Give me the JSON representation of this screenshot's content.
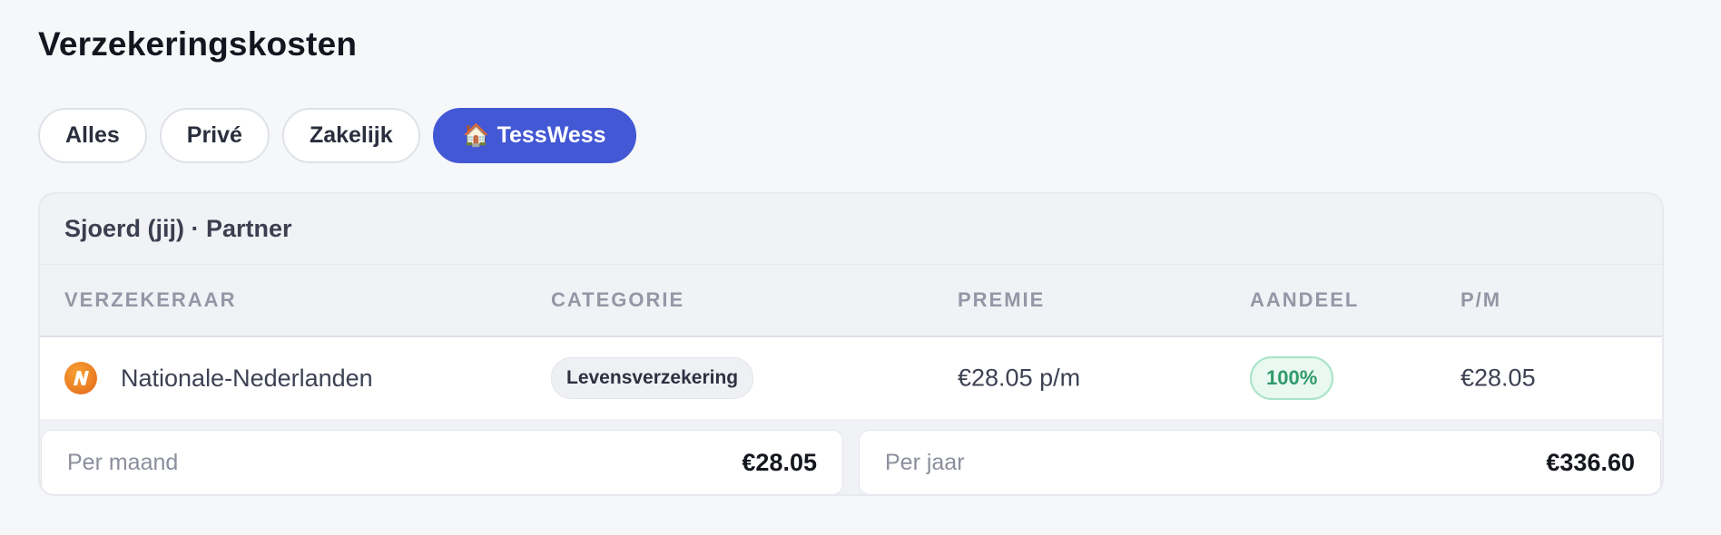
{
  "page": {
    "title": "Verzekeringskosten"
  },
  "filters": [
    {
      "label": "Alles",
      "active": false
    },
    {
      "label": "Privé",
      "active": false
    },
    {
      "label": "Zakelijk",
      "active": false
    },
    {
      "label": "TessWess",
      "active": true,
      "icon": "house-icon"
    }
  ],
  "group": {
    "title": "Sjoerd (jij) · Partner"
  },
  "table": {
    "columns": [
      "VERZEKERAAR",
      "CATEGORIE",
      "PREMIE",
      "AANDEEL",
      "P/M"
    ],
    "rows": [
      {
        "insurer": "Nationale-Nederlanden",
        "insurer_logo": "nn-logo-icon",
        "category": "Levensverzekering",
        "premium": "€28.05 p/m",
        "share": "100%",
        "per_month": "€28.05"
      }
    ]
  },
  "totals": {
    "monthly_label": "Per maand",
    "monthly_value": "€28.05",
    "yearly_label": "Per jaar",
    "yearly_value": "€336.60"
  },
  "colors": {
    "accent": "#4358d4",
    "share_badge": "#2f9a6a",
    "logo_orange": "#e3661a"
  }
}
